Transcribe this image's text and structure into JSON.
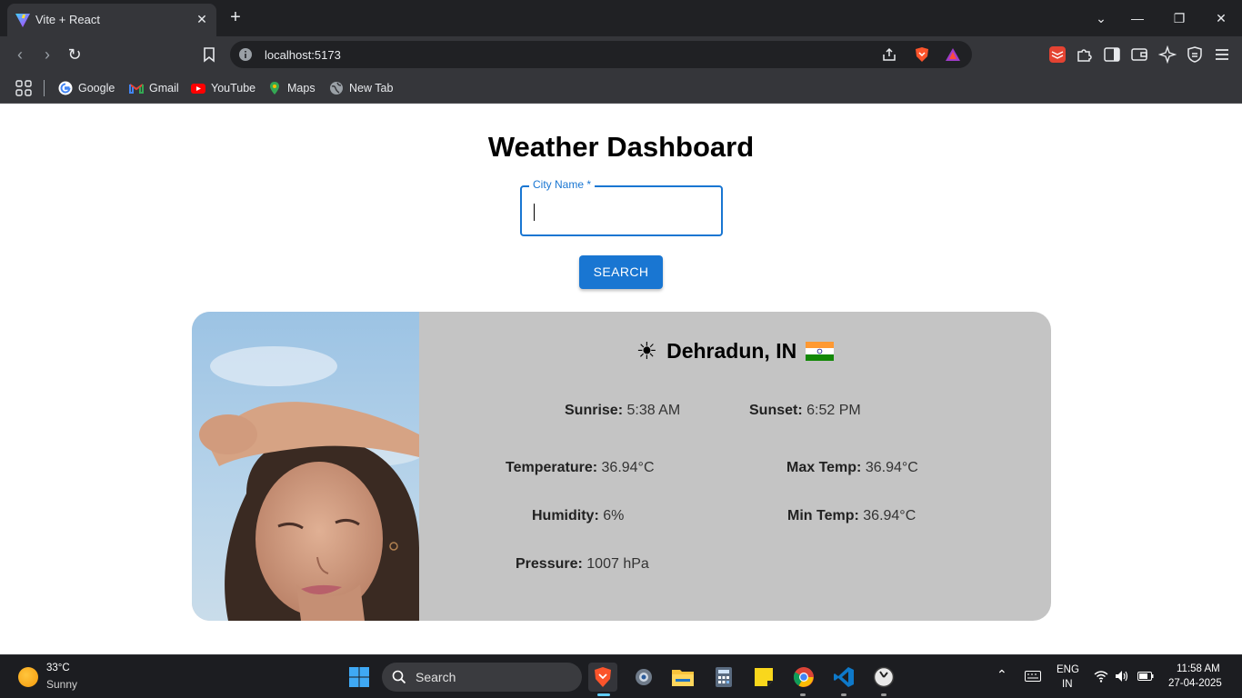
{
  "browser": {
    "tab_title": "Vite + React",
    "url": "localhost:5173",
    "bookmarks": [
      {
        "label": "Google",
        "icon": "google-icon"
      },
      {
        "label": "Gmail",
        "icon": "gmail-icon"
      },
      {
        "label": "YouTube",
        "icon": "youtube-icon"
      },
      {
        "label": "Maps",
        "icon": "maps-icon"
      },
      {
        "label": "New Tab",
        "icon": "globe-icon"
      }
    ]
  },
  "page": {
    "title": "Weather Dashboard",
    "city_field_label": "City Name *",
    "city_field_value": "",
    "search_button": "SEARCH"
  },
  "weather": {
    "location": "Dehradun, IN",
    "condition_icon": "sun-icon",
    "sunrise_label": "Sunrise:",
    "sunrise": "5:38 AM",
    "sunset_label": "Sunset:",
    "sunset": "6:52 PM",
    "temperature_label": "Temperature:",
    "temperature": "36.94°C",
    "max_temp_label": "Max Temp:",
    "max_temp": "36.94°C",
    "humidity_label": "Humidity:",
    "humidity": "6%",
    "min_temp_label": "Min Temp:",
    "min_temp": "36.94°C",
    "pressure_label": "Pressure:",
    "pressure": "1007 hPa"
  },
  "taskbar": {
    "weather_temp": "33°C",
    "weather_condition": "Sunny",
    "search_label": "Search",
    "language_top": "ENG",
    "language_bottom": "IN",
    "time": "11:58 AM",
    "date": "27-04-2025"
  },
  "colors": {
    "primary": "#1976d2",
    "card_bg": "#c4c4c4",
    "browser_chrome": "#35363a"
  }
}
